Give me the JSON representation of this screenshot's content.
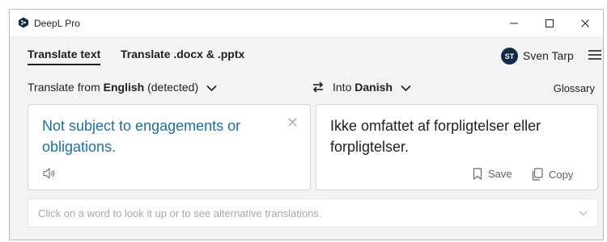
{
  "window": {
    "title": "DeepL Pro",
    "controls": {
      "minimize": "—",
      "maximize": "☐",
      "close": "✕"
    }
  },
  "toolbar": {
    "tabs": [
      {
        "label": "Translate text",
        "active": true
      },
      {
        "label": "Translate .docx & .pptx",
        "active": false
      }
    ],
    "user": {
      "initials": "ST",
      "name": "Sven Tarp"
    }
  },
  "languages": {
    "from_prefix": "Translate from",
    "from_language": "English",
    "from_suffix": "(detected)",
    "to_prefix": "Into",
    "to_language": "Danish",
    "glossary": "Glossary"
  },
  "source": {
    "text": "Not subject to engagements or obligations.",
    "clear": "✕"
  },
  "target": {
    "text": "Ikke omfattet af forpligtelser eller forpligtelser.",
    "save": "Save",
    "copy": "Copy"
  },
  "lookup": {
    "placeholder": "Click on a word to look it up or to see alternative translations."
  },
  "colors": {
    "source_text": "#1d6fa5",
    "avatar": "#0f2b46",
    "window_bg": "#f3f3f3"
  }
}
